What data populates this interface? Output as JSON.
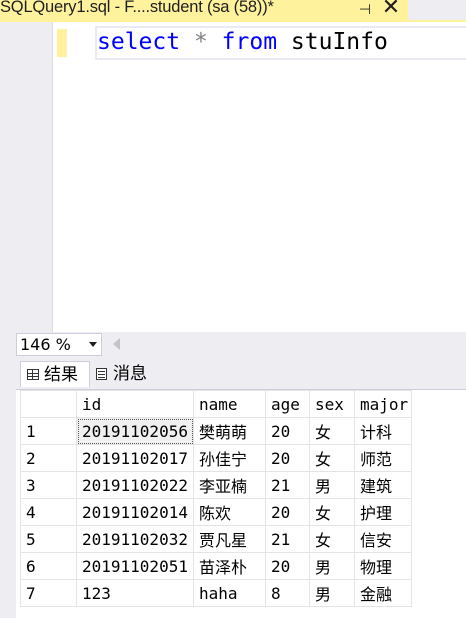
{
  "tab": {
    "title": "SQLQuery1.sql - F....student (sa (58))*",
    "pin_icon": "⊣",
    "close_icon": "✕"
  },
  "editor": {
    "tokens": {
      "select": "select",
      "star": "*",
      "from": "from",
      "table": "stuInfo"
    }
  },
  "zoom": {
    "value": "146 %"
  },
  "results_tabs": {
    "results": "结果",
    "messages": "消息"
  },
  "grid": {
    "columns": [
      "",
      "id",
      "name",
      "age",
      "sex",
      "major"
    ],
    "rows": [
      [
        "1",
        "20191102056",
        "樊萌萌",
        "20",
        "女",
        "计科"
      ],
      [
        "2",
        "20191102017",
        "孙佳宁",
        "20",
        "女",
        "师范"
      ],
      [
        "3",
        "20191102022",
        "李亚楠",
        "21",
        "男",
        "建筑"
      ],
      [
        "4",
        "20191102014",
        "陈欢",
        "20",
        "女",
        "护理"
      ],
      [
        "5",
        "20191102032",
        "贾凡星",
        "21",
        "女",
        "信安"
      ],
      [
        "6",
        "20191102051",
        "苗泽朴",
        "20",
        "男",
        "物理"
      ],
      [
        "7",
        "123",
        "haha",
        "8",
        "男",
        "金融"
      ]
    ]
  },
  "colors": {
    "tab_active": "#fff29d",
    "keyword": "#0000ff",
    "operator": "#808080",
    "chrome": "#eeeef2"
  }
}
